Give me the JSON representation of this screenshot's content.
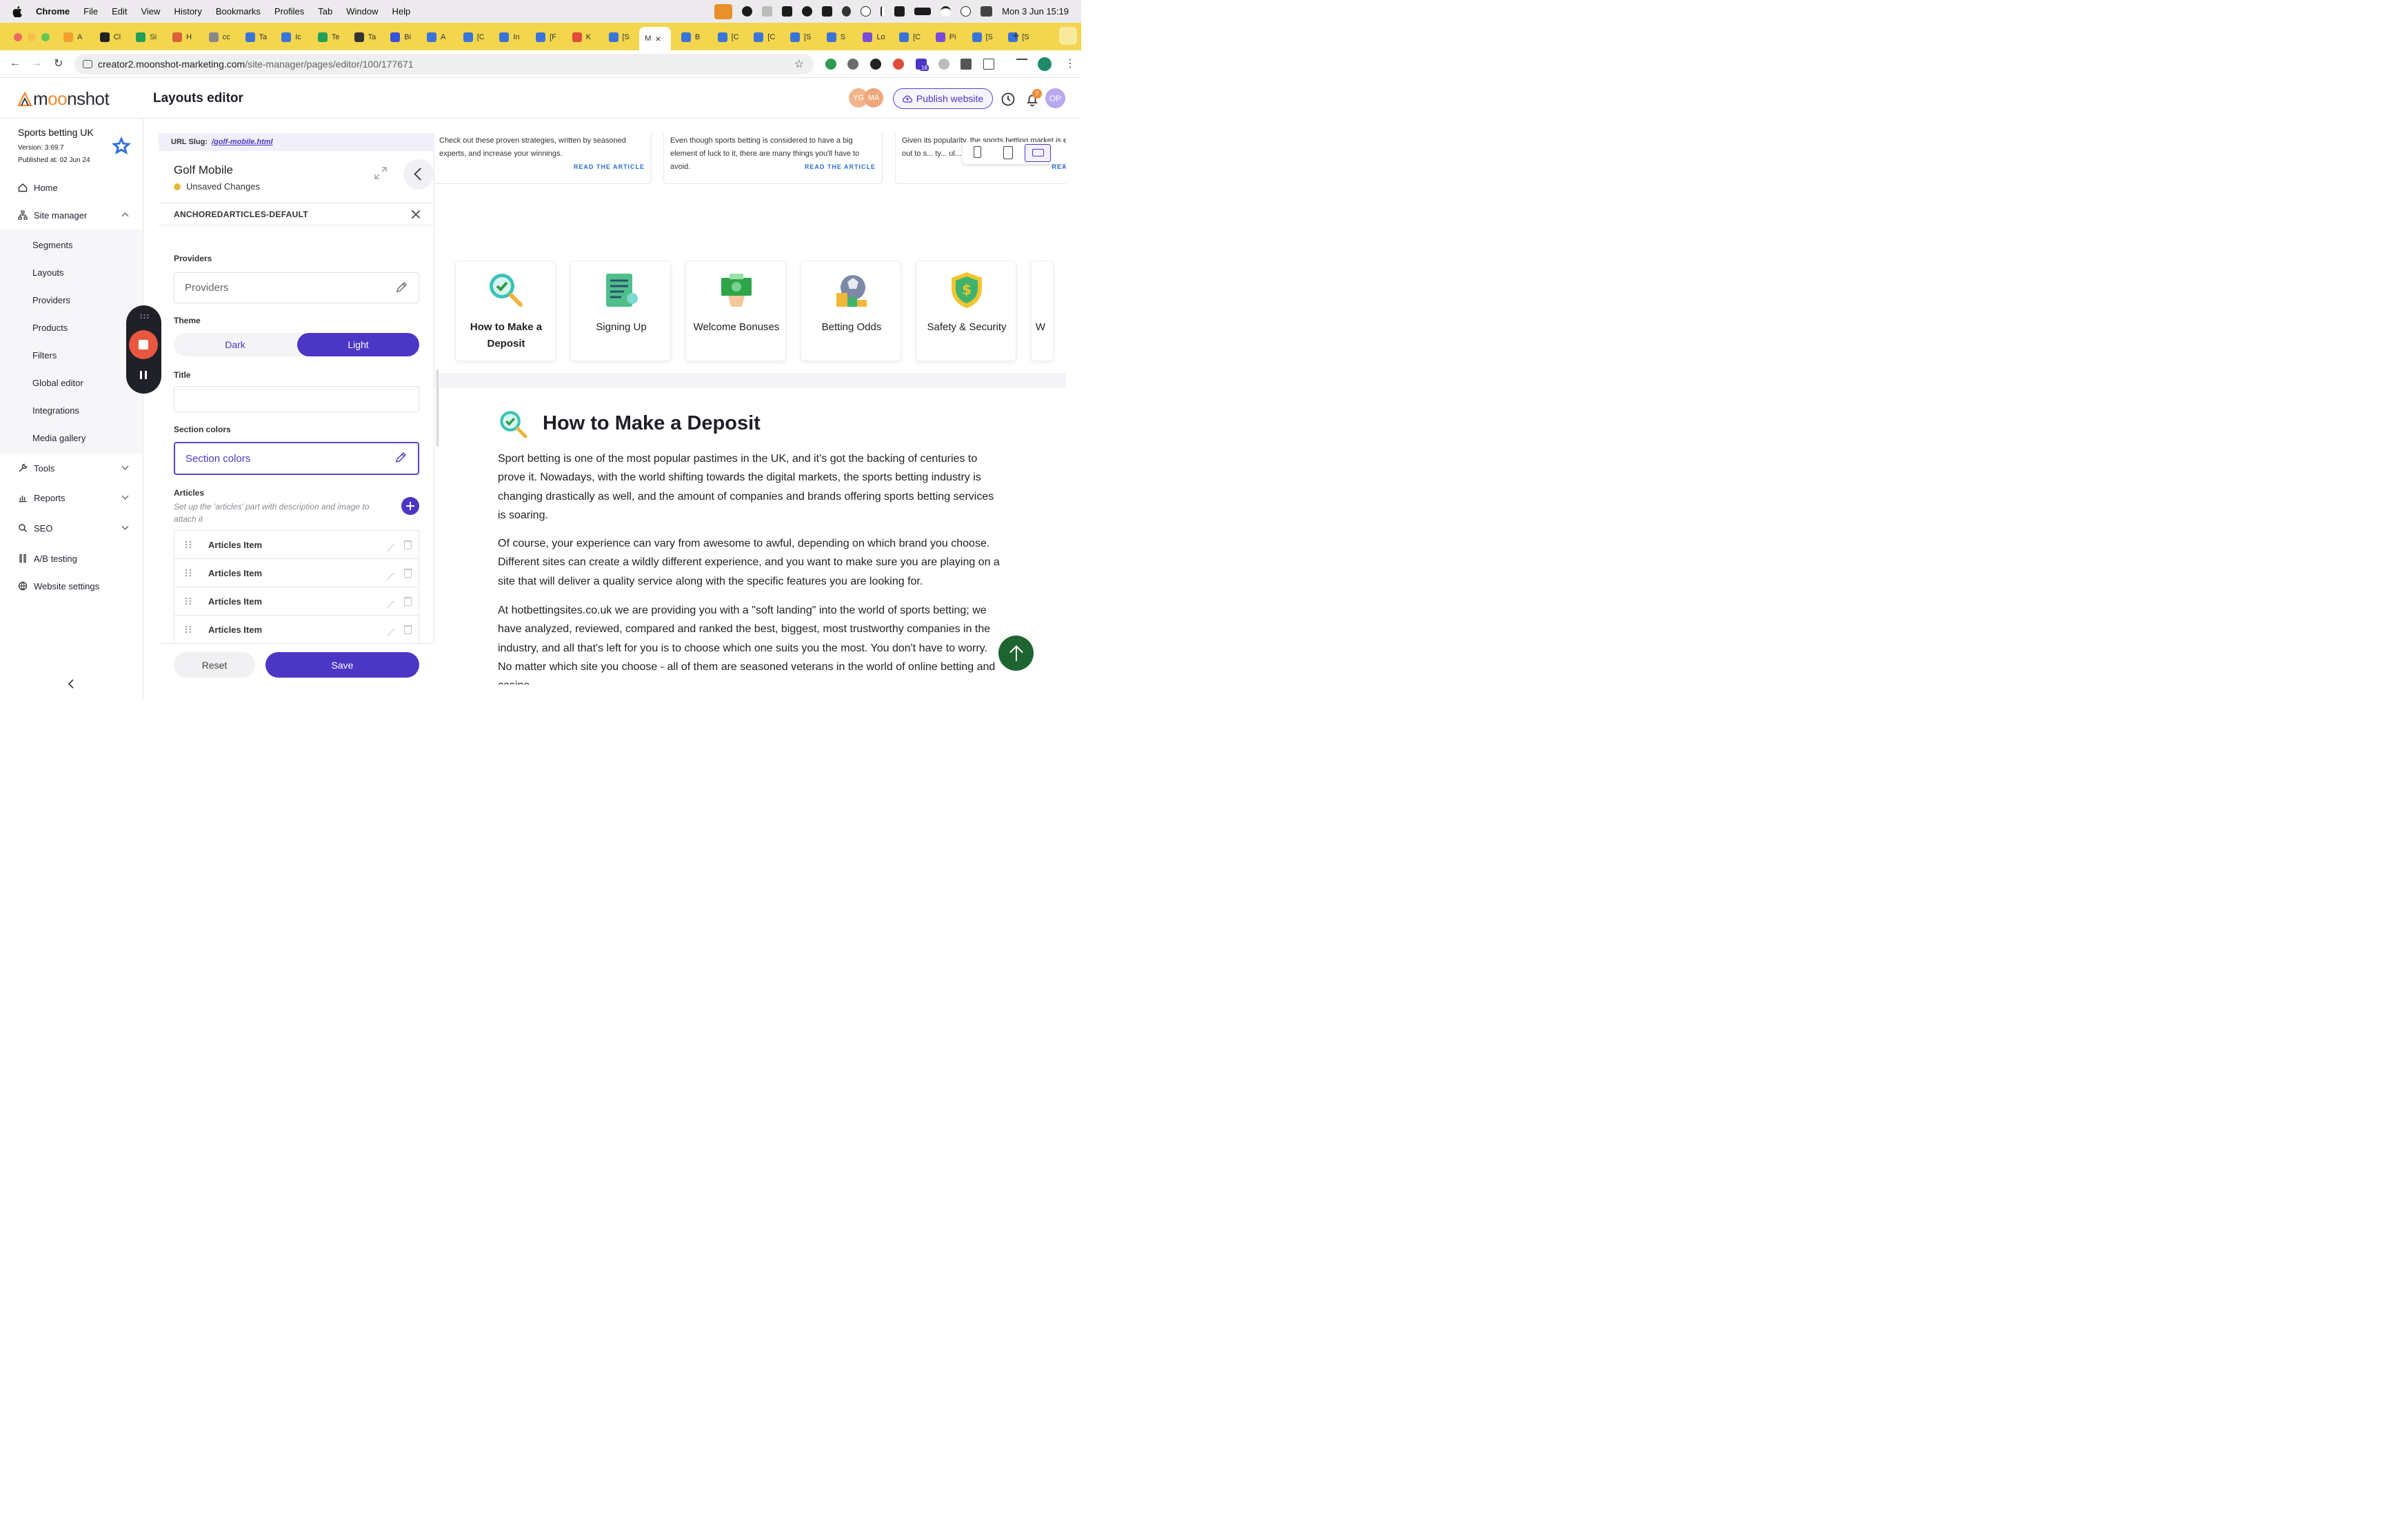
{
  "menubar": {
    "app": "Chrome",
    "items": [
      "File",
      "Edit",
      "View",
      "History",
      "Bookmarks",
      "Profiles",
      "Tab",
      "Window",
      "Help"
    ],
    "clock": "Mon 3 Jun  15:19"
  },
  "tabs": [
    "A",
    "Cl",
    "Si",
    "H",
    "cc",
    "Ta",
    "Ic",
    "Te",
    "Ta",
    "Bi",
    "A",
    "[C",
    "In",
    "[F",
    "K",
    "[S",
    "M",
    "B",
    "[C",
    "[C",
    "[S",
    "S",
    "Lo",
    "[C",
    "Pi",
    "[S",
    "[S"
  ],
  "active_tab_index": 16,
  "address": {
    "host": "creator2.moonshot-marketing.com",
    "path": "/site-manager/pages/editor/100/177671",
    "ext_badge": "18"
  },
  "header": {
    "logo": "moonshot",
    "title": "Layouts editor",
    "avatars": [
      "YG",
      "MA"
    ],
    "publish_label": "Publish website",
    "notif_count": "7",
    "user_initials": "OP"
  },
  "sidebar": {
    "site_name": "Sports betting UK",
    "version": "Version: 3.69.7",
    "published": "Published at: 02 Jun 24",
    "home": "Home",
    "site_manager": "Site manager",
    "sub_items": [
      "Segments",
      "Layouts",
      "Providers",
      "Products",
      "Filters",
      "Global editor",
      "Integrations",
      "Media gallery"
    ],
    "tools": "Tools",
    "reports": "Reports",
    "seo": "SEO",
    "ab_testing": "A/B testing",
    "website_settings": "Website settings"
  },
  "editor": {
    "slug_label": "URL Slug:",
    "slug_value": "/golf-mobile.html",
    "name": "Golf Mobile",
    "status": "Unsaved Changes",
    "section": "ANCHOREDARTICLES-DEFAULT",
    "providers_label": "Providers",
    "providers_value": "Providers",
    "theme_label": "Theme",
    "theme_dark": "Dark",
    "theme_light": "Light",
    "title_label": "Title",
    "title_value": "",
    "section_colors_label": "Section colors",
    "section_colors_value": "Section colors",
    "articles_label": "Articles",
    "articles_help": "Set up the 'articles' part with description and image to attach it",
    "article_items": [
      "Articles Item",
      "Articles Item",
      "Articles Item",
      "Articles Item"
    ],
    "reset": "Reset",
    "save": "Save"
  },
  "preview": {
    "top_cards": [
      {
        "text": "Check out these proven strategies, written by seasoned experts, and increase your winnings.",
        "link": "READ THE ARTICLE"
      },
      {
        "text": "Even though sports betting is considered to have a big element of luck to it, there are many things you'll have to avoid.",
        "link": "READ THE ARTICLE"
      },
      {
        "text": "Given its popularity, the sports betting market is e... Check this out to s... ty... ul... our p...",
        "link": "READ"
      }
    ],
    "categories": [
      "How to Make a Deposit",
      "Signing Up",
      "Welcome Bonuses",
      "Betting Odds",
      "Safety & Security",
      "W"
    ],
    "heading": "How to Make a Deposit",
    "paragraphs": [
      "Sport betting is one of the most popular pastimes in the UK, and it’s got the backing of centuries to prove it. Nowadays, with the world shifting towards the digital markets, the sports betting industry is changing drastically as well, and the amount of companies and brands offering sports betting services is soaring.",
      "Of course, your experience can vary from awesome to awful, depending on which brand you choose. Different sites can create a wildly different experience, and you want to make sure you are playing on a site that will deliver a quality service along with the specific features you are looking for.",
      "At hotbettingsites.co.uk we are providing you with a \"soft landing\" into the world of sports betting; we have analyzed, reviewed, compared and ranked the best, biggest, most trustworthy companies in the industry, and all that's left for you is to choose which one suits you the most. You don't have to worry. No matter which site you choose - all of them are seasoned veterans in the world of online betting and casino."
    ]
  },
  "colors": {
    "accent": "#4b36c6",
    "tabstrip": "#f3d64e",
    "brand_orange": "#f08c36",
    "scroll_top": "#1e6431"
  }
}
